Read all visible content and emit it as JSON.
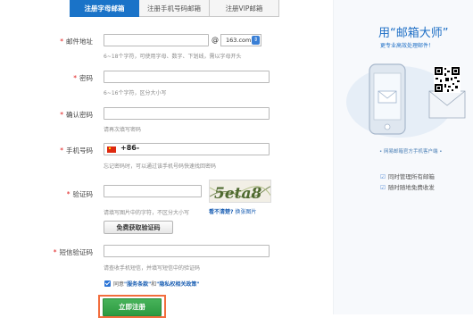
{
  "tabs": [
    {
      "label": "注册字母邮箱",
      "active": true
    },
    {
      "label": "注册手机号码邮箱",
      "active": false
    },
    {
      "label": "注册VIP邮箱",
      "active": false
    }
  ],
  "form": {
    "email": {
      "label": "邮件地址",
      "hint": "6~18个字符，可使用字母、数字、下划线，需以字母开头",
      "at": "@",
      "domain": "163.com"
    },
    "password": {
      "label": "密码",
      "hint": "6~16个字符，区分大小写"
    },
    "confirm": {
      "label": "确认密码",
      "hint": "请再次填写密码"
    },
    "phone": {
      "label": "手机号码",
      "country_code": "+86-",
      "hint": "忘记密码时，可以通过该手机号码快速找回密码"
    },
    "captcha": {
      "label": "验证码",
      "hint": "请填写图片中的字符，不区分大小写",
      "image_text": "5eta8",
      "refresh_q": "看不清楚?",
      "refresh_link": "换张图片"
    },
    "sms_button": "免费获取验证码",
    "sms": {
      "label": "短信验证码",
      "hint": "请查收手机短信，并填写短信中的验证码"
    },
    "required_mark": "*"
  },
  "agreement": {
    "prefix": "同意",
    "terms": "\"服务条款\"",
    "and": "和",
    "privacy": "\"隐私权相关政策\""
  },
  "submit_label": "立即注册",
  "side": {
    "title": "用“邮箱大师”",
    "subtitle": "更专业高效处理邮件！",
    "download": "• 网易邮箱官方手机客户端 •",
    "features": [
      "同时管理所有邮箱",
      "随时随地免费收发"
    ]
  },
  "colors": {
    "accent": "#1a73c8",
    "submit": "#2d9a41",
    "highlight": "#f26d3d",
    "required": "#e02020"
  }
}
